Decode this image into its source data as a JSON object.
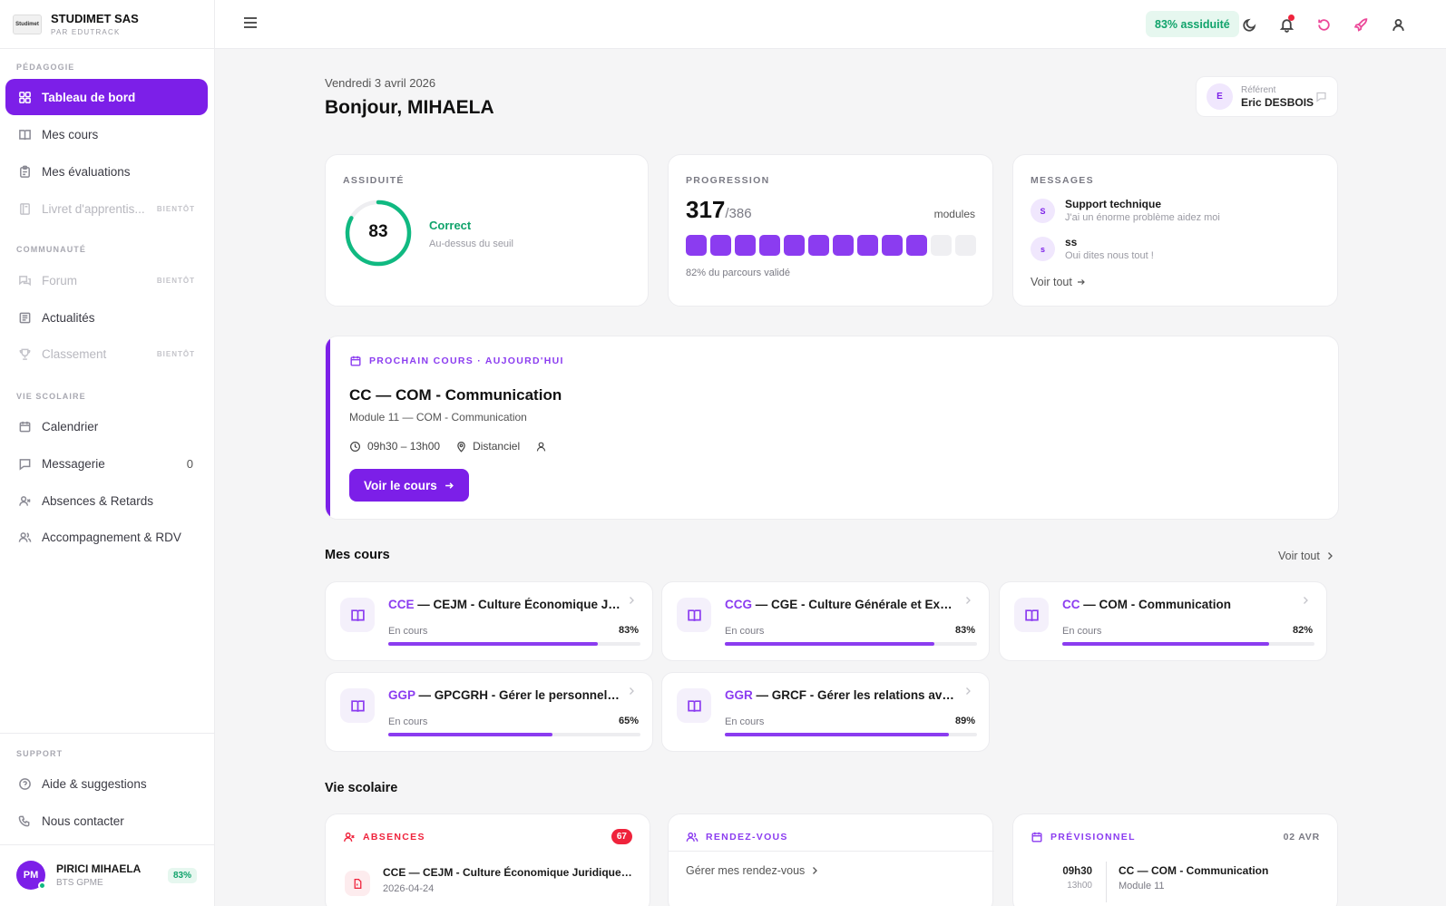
{
  "brand": {
    "logo_text": "Studimet",
    "name": "STUDIMET SAS",
    "sub": "PAR EDUTRACK"
  },
  "sidebar": {
    "sections": {
      "pedagogie": "PÉDAGOGIE",
      "communaute": "COMMUNAUTÉ",
      "vie_scolaire": "VIE SCOLAIRE",
      "support": "SUPPORT"
    },
    "items": {
      "dashboard": "Tableau de bord",
      "courses": "Mes cours",
      "evaluations": "Mes évaluations",
      "livret": "Livret d'apprentis...",
      "forum": "Forum",
      "actualites": "Actualités",
      "classement": "Classement",
      "calendrier": "Calendrier",
      "messagerie": "Messagerie",
      "absences": "Absences & Retards",
      "accompagnement": "Accompagnement & RDV",
      "aide": "Aide & suggestions",
      "contact": "Nous contacter"
    },
    "soon_label": "BIENTÔT",
    "messagerie_count": "0",
    "user": {
      "initials": "PM",
      "name": "PIRICI MIHAELA",
      "program": "BTS GPME",
      "attendance": "83%"
    }
  },
  "topbar": {
    "attendance_badge": "83% assiduité"
  },
  "header": {
    "date": "Vendredi 3 avril 2026",
    "greeting": "Bonjour, MIHAELA"
  },
  "referent": {
    "initial": "E",
    "label": "Référent",
    "name": "Eric DESBOIS"
  },
  "assiduite": {
    "label": "ASSIDUITÉ",
    "value": 83,
    "value_text": "83",
    "status": "Correct",
    "status_sub": "Au-dessus du seuil",
    "ring_color": "#10b981"
  },
  "progression": {
    "label": "PROGRESSION",
    "done": "317",
    "total": "/386",
    "unit": "modules",
    "filled_blocks": 10,
    "total_blocks": 12,
    "caption": "82% du parcours validé"
  },
  "messages": {
    "label": "MESSAGES",
    "items": [
      {
        "initial": "S",
        "title": "Support technique",
        "text": "J'ai un énorme problème aidez moi"
      },
      {
        "initial": "s",
        "title": "ss",
        "text": "Oui dites nous tout !"
      }
    ],
    "see_all": "Voir tout"
  },
  "next_course": {
    "label": "PROCHAIN COURS · AUJOURD'HUI",
    "title": "CC — COM - Communication",
    "subtitle": "Module 11 — COM - Communication",
    "time": "09h30 – 13h00",
    "location": "Distanciel",
    "button": "Voir le cours"
  },
  "my_courses": {
    "title": "Mes cours",
    "see_all": "Voir tout",
    "items": [
      {
        "code": "CCE",
        "name": " — CEJM - Culture Économique Juridique et Managériale",
        "status": "En cours",
        "progress": 83,
        "progress_text": "83%"
      },
      {
        "code": "CCG",
        "name": " — CGE - Culture Générale et Expression",
        "status": "En cours",
        "progress": 83,
        "progress_text": "83%"
      },
      {
        "code": "CC",
        "name": " — COM - Communication",
        "status": "En cours",
        "progress": 82,
        "progress_text": "82%"
      },
      {
        "code": "GGP",
        "name": " — GPCGRH - Gérer le personnel et contribuer",
        "status": "En cours",
        "progress": 65,
        "progress_text": "65%"
      },
      {
        "code": "GGR",
        "name": " — GRCF - Gérer les relations avec les clients",
        "status": "En cours",
        "progress": 89,
        "progress_text": "89%"
      }
    ]
  },
  "vie_scolaire": {
    "title": "Vie scolaire",
    "absences": {
      "label": "ABSENCES",
      "count": "67",
      "item_title": "CCE — CEJM - Culture Économique Juridique et Managériale",
      "item_date": "2026-04-24"
    },
    "rdv": {
      "label": "RENDEZ-VOUS",
      "link": "Gérer mes rendez-vous"
    },
    "previsionnel": {
      "label": "PRÉVISIONNEL",
      "date": "02 AVR",
      "time": "09h30",
      "time_end": "13h00",
      "course": "CC — COM - Communication",
      "module": "Module 11"
    }
  },
  "colors": {
    "accent": "#7c1fe8",
    "success": "#10b981",
    "danger": "#ef233c"
  }
}
